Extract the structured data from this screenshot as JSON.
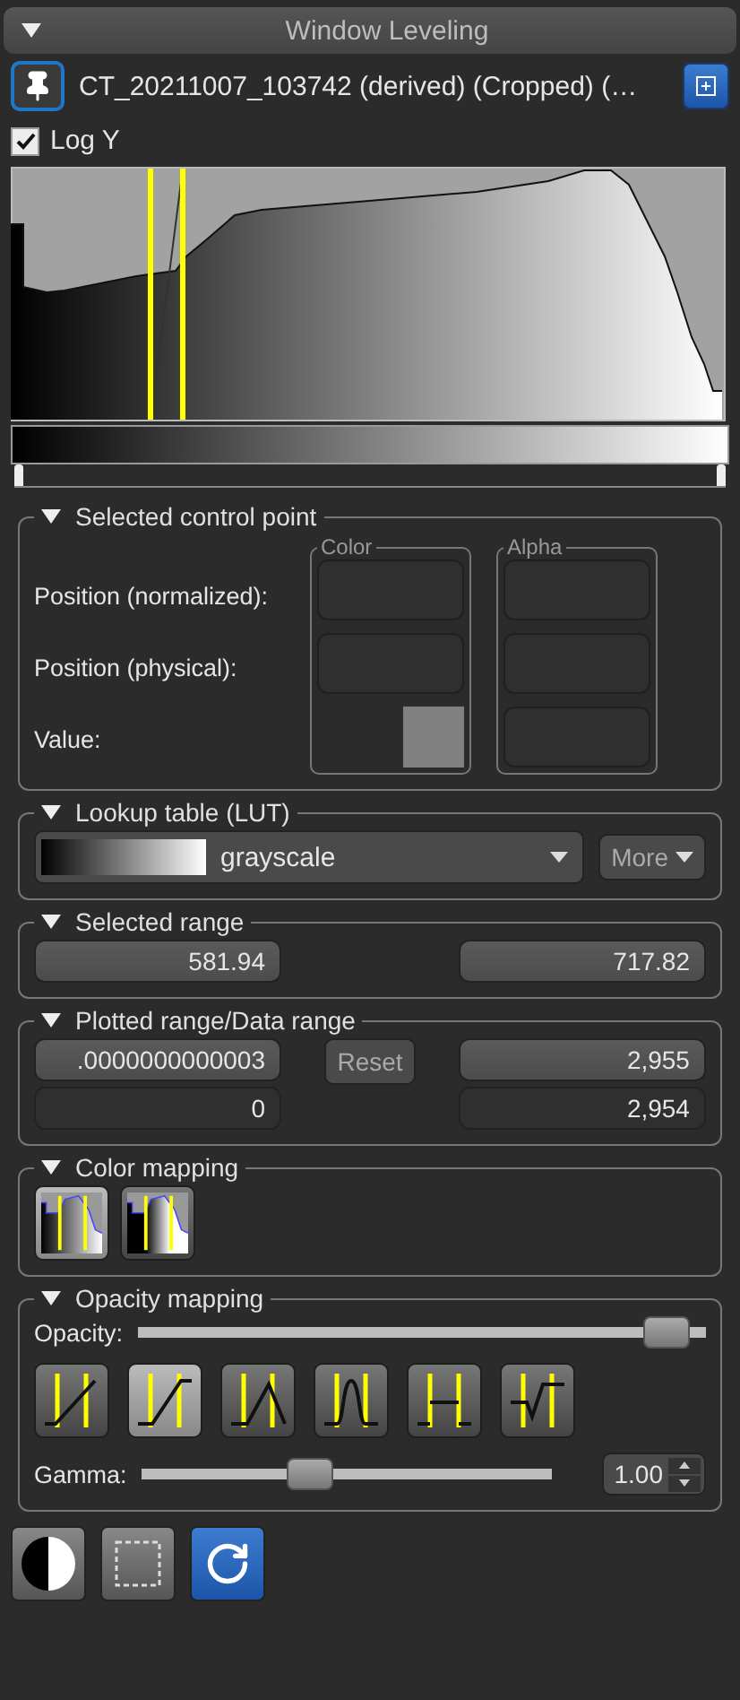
{
  "panel": {
    "title": "Window Leveling",
    "expanded": true
  },
  "volume": {
    "name": "CT_20211007_103742 (derived) (Cropped) (…"
  },
  "log_y": {
    "label": "Log Y",
    "checked": true
  },
  "range_handles": [
    {
      "level": 0
    },
    {
      "level": 1
    }
  ],
  "control_point": {
    "title": "Selected control point",
    "expanded": true,
    "labels": [
      "Position (normalized):",
      "Position (physical):",
      "Value:"
    ],
    "color_group": "Color",
    "alpha_group": "Alpha"
  },
  "lut": {
    "title": "Lookup table (LUT)",
    "expanded": true,
    "value": "grayscale",
    "more": "More"
  },
  "selected_range": {
    "title": "Selected range",
    "expanded": true,
    "min": "581.94",
    "max": "717.82"
  },
  "plotted_range": {
    "title": "Plotted range/Data range",
    "expanded": true,
    "plot_min": ".0000000000003",
    "reset": "Reset",
    "plot_max": "2,955",
    "data_min": "0",
    "data_max": "2,954"
  },
  "color_mapping": {
    "title": "Color mapping",
    "expanded": true,
    "modes": [
      {
        "selected": true
      },
      {
        "selected": false
      }
    ]
  },
  "opacity_mapping": {
    "title": "Opacity mapping",
    "expanded": true,
    "opacity_label": "Opacity:",
    "opacity": {
      "level": 0.97
    },
    "modes": [
      {
        "kind": "linear",
        "selected": false
      },
      {
        "kind": "ramp",
        "selected": true
      },
      {
        "kind": "window",
        "selected": false
      },
      {
        "kind": "bell",
        "selected": false
      },
      {
        "kind": "flat",
        "selected": false
      },
      {
        "kind": "sigmoid",
        "selected": false
      }
    ],
    "gamma_label": "Gamma:",
    "gamma": {
      "level": 0.4
    },
    "gamma_value": "1.00"
  },
  "tools": [
    {
      "kind": "contrast",
      "selected": false
    },
    {
      "kind": "region",
      "selected": false
    },
    {
      "kind": "reset",
      "selected": true
    }
  ]
}
